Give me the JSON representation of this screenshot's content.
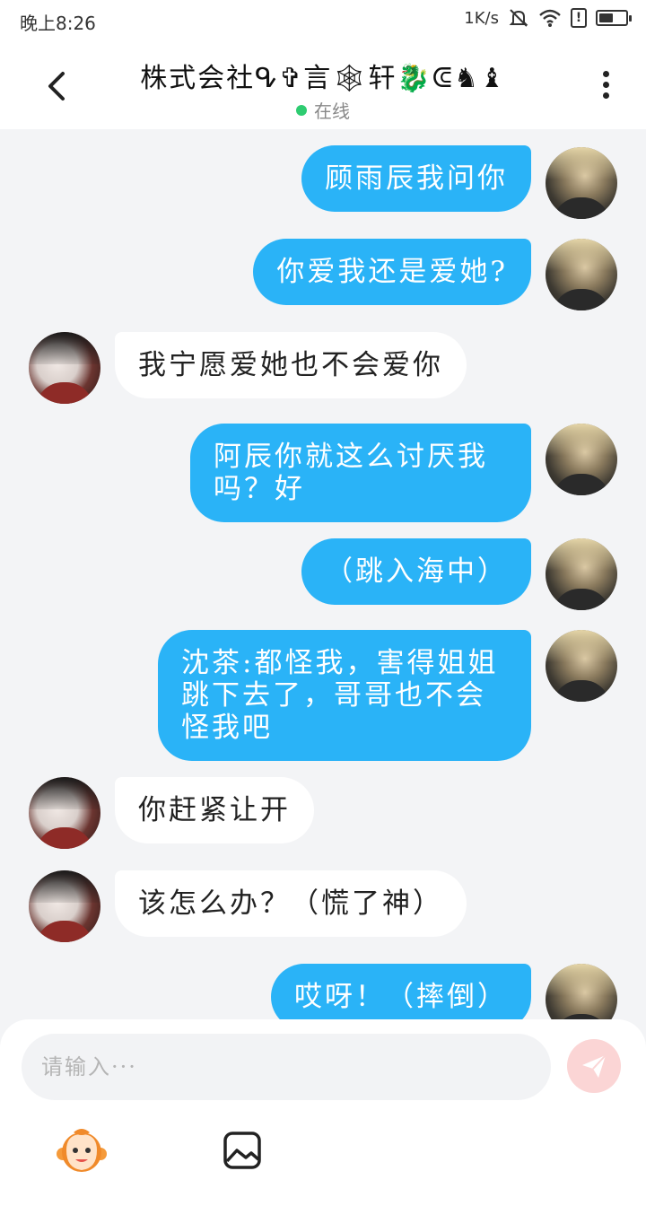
{
  "status_bar": {
    "time": "晚上8:26",
    "net_speed": "1K/s",
    "battery_level": 0.55
  },
  "header": {
    "title": "株式会社ᕴ✞言🕸轩🐉ᕳ♞♝",
    "status": "在线",
    "online_color": "#2ecc71"
  },
  "messages": [
    {
      "side": "me",
      "text": "顾雨辰我问你"
    },
    {
      "side": "me",
      "text": "你爱我还是爱她?"
    },
    {
      "side": "other",
      "text": "我宁愿爱她也不会爱你"
    },
    {
      "side": "me",
      "text": "阿辰你就这么讨厌我吗？好"
    },
    {
      "side": "me",
      "text": "（跳入海中）"
    },
    {
      "side": "me",
      "text": "沈茶:都怪我，害得姐姐跳下去了，哥哥也不会怪我吧"
    },
    {
      "side": "other",
      "text": "你赶紧让开"
    },
    {
      "side": "other",
      "text": "该怎么办？（慌了神）"
    },
    {
      "side": "me",
      "text": "哎呀！（摔倒）"
    }
  ],
  "input": {
    "placeholder": "请输入···"
  },
  "colors": {
    "my_bubble": "#2ab3f7",
    "other_bubble": "#ffffff",
    "background": "#f3f4f6",
    "send_button": "#fbd5d5"
  },
  "icons": {
    "back": "chevron-left-icon",
    "more": "more-vertical-icon",
    "send": "paper-plane-icon",
    "emoji": "monkey-face-icon",
    "image": "image-icon"
  }
}
